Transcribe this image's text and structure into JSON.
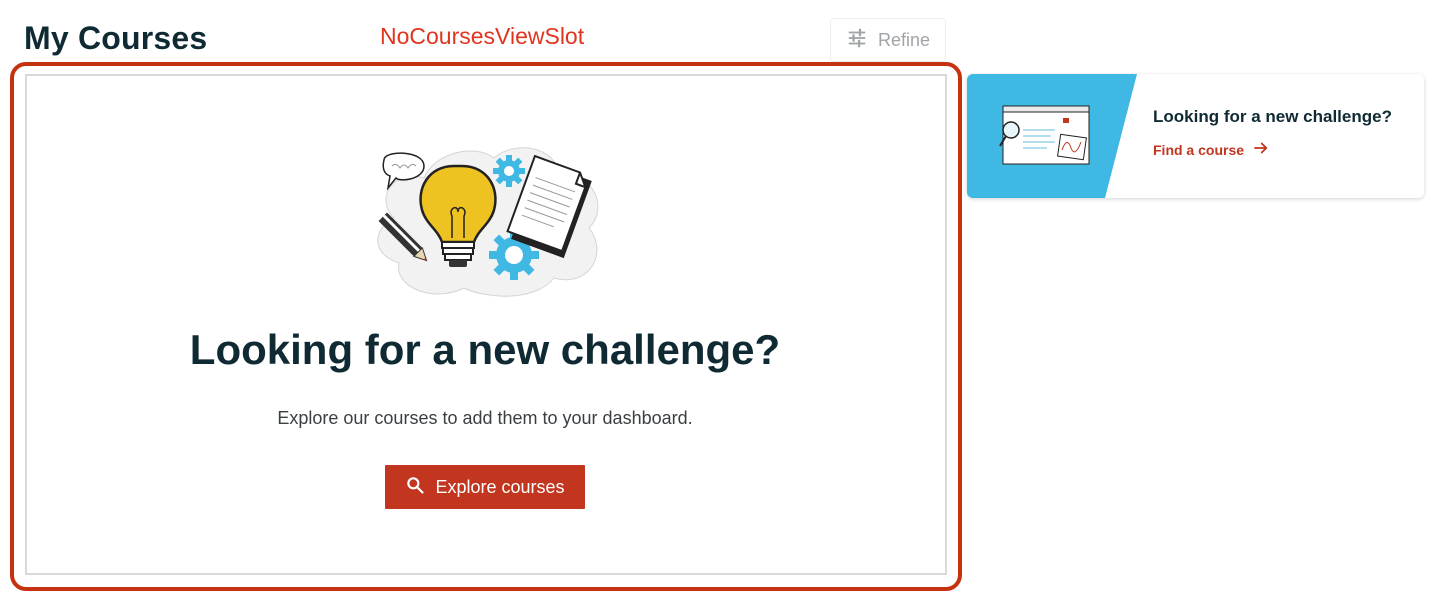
{
  "header": {
    "title": "My Courses",
    "slot_label": "NoCoursesViewSlot",
    "refine_label": "Refine"
  },
  "empty_state": {
    "heading": "Looking for a new challenge?",
    "subtext": "Explore our courses to add them to your dashboard.",
    "button_label": "Explore courses"
  },
  "sidebar_card": {
    "title": "Looking for a new challenge?",
    "link_label": "Find a course"
  },
  "colors": {
    "brand_red": "#c2351f",
    "slot_outline": "#c6320f",
    "accent_blue": "#3fb8e4",
    "bulb_yellow": "#eec321",
    "heading_text": "#0f2a33"
  },
  "icons": [
    "sliders-icon",
    "search-icon",
    "arrow-right-icon"
  ]
}
